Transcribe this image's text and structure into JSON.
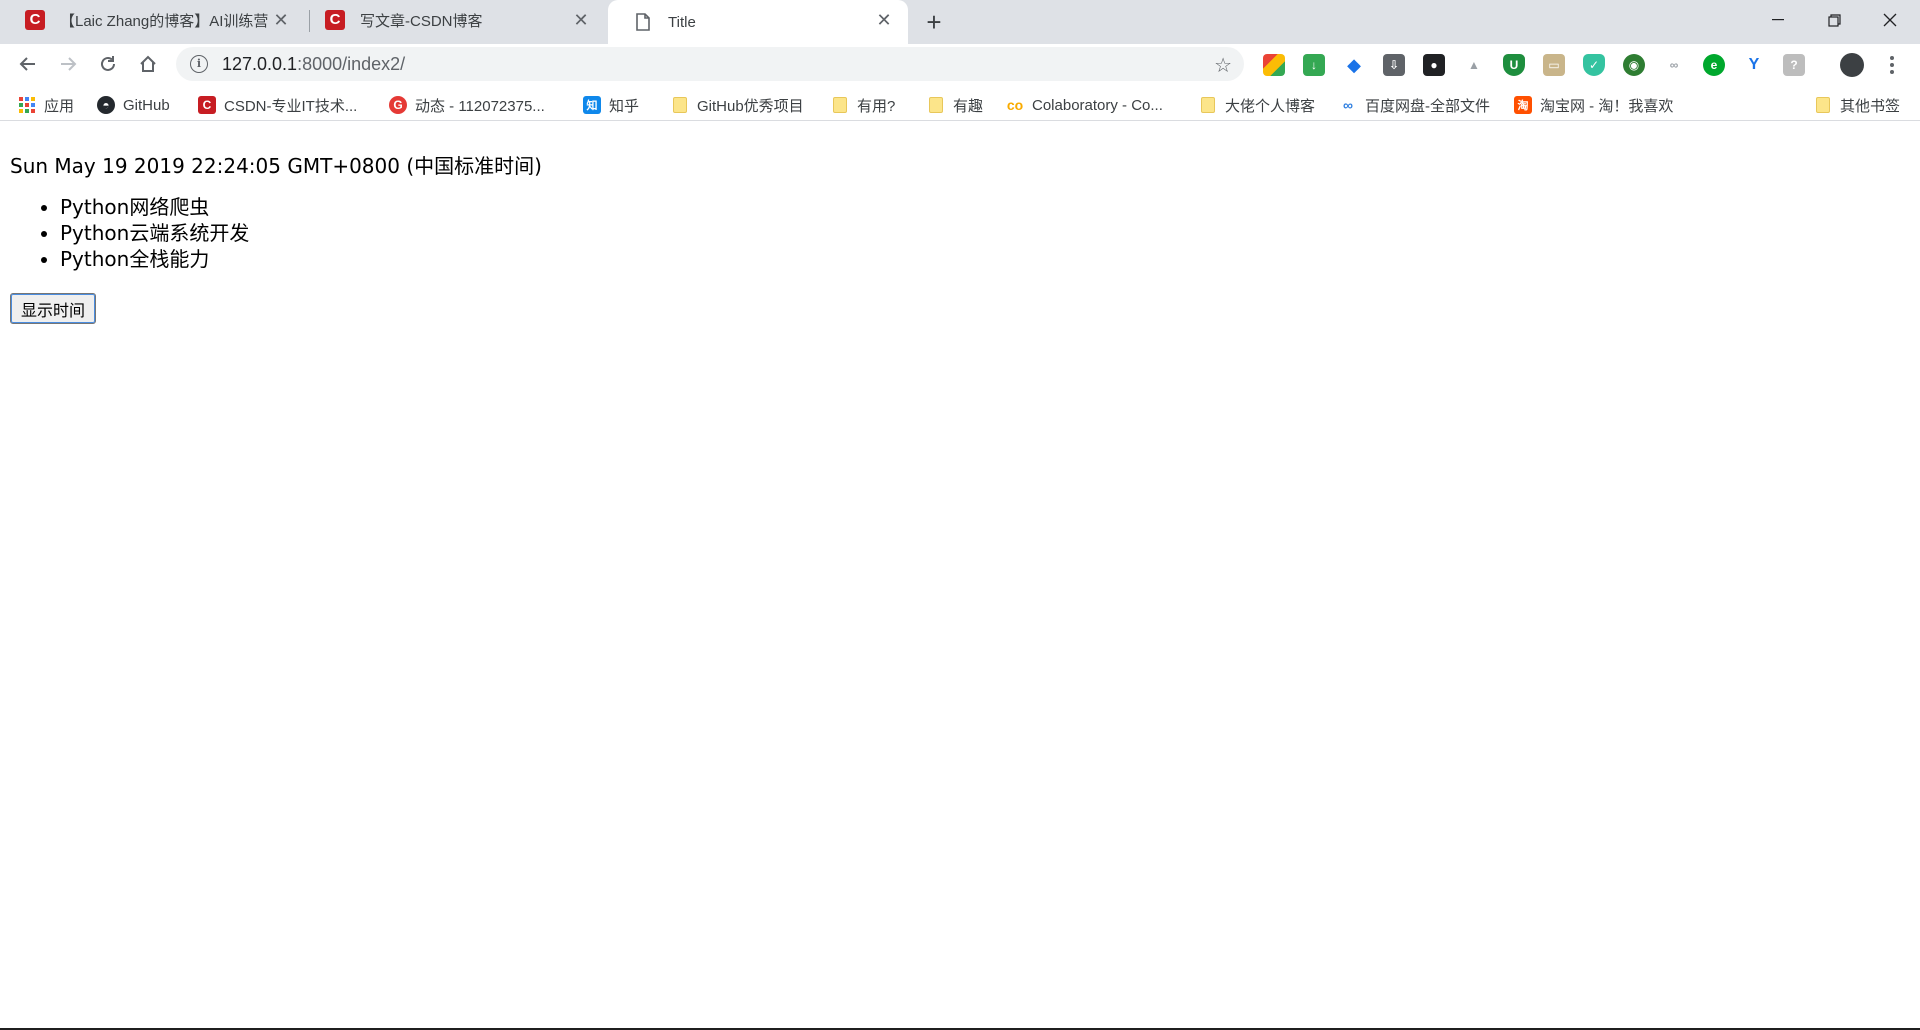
{
  "tabs": [
    {
      "title": "【Laic Zhang的博客】AI训练营",
      "icon": "csdn-logo"
    },
    {
      "title": "写文章-CSDN博客",
      "icon": "csdn-logo"
    },
    {
      "title": "Title",
      "icon": "document-icon",
      "active": true
    }
  ],
  "address_bar": {
    "host": "127.0.0.1",
    "path": ":8000/index2/"
  },
  "bookmarks": [
    {
      "label": "应用",
      "icon": "apps-grid-icon"
    },
    {
      "label": "GitHub",
      "icon": "github-icon"
    },
    {
      "label": "CSDN-专业IT技术...",
      "icon": "csdn-logo"
    },
    {
      "label": "动态 - 112072375...",
      "icon": "g-circle-icon"
    },
    {
      "label": "知乎",
      "icon": "zhihu-icon"
    },
    {
      "label": "GitHub优秀项目",
      "icon": "folder-icon"
    },
    {
      "label": "有用?",
      "icon": "folder-icon"
    },
    {
      "label": "有趣",
      "icon": "folder-icon"
    },
    {
      "label": "Colaboratory - Co...",
      "icon": "colab-icon"
    },
    {
      "label": "大佬个人博客",
      "icon": "folder-icon"
    },
    {
      "label": "百度网盘-全部文件",
      "icon": "baidu-pan-icon"
    },
    {
      "label": "淘宝网 - 淘！我喜欢",
      "icon": "taobao-icon"
    },
    {
      "label": "其他书签",
      "icon": "folder-icon"
    }
  ],
  "page": {
    "time_text": "Sun May 19 2019 22:24:05 GMT+0800 (中国标准时间)",
    "courses": [
      "Python网络爬虫",
      "Python云端系统开发",
      "Python全栈能力"
    ],
    "button_label": "显示时间"
  },
  "colors": {
    "tabstrip_bg": "#dee1e6",
    "csdn_red": "#c71d23",
    "button_focus": "#4a8de0"
  }
}
